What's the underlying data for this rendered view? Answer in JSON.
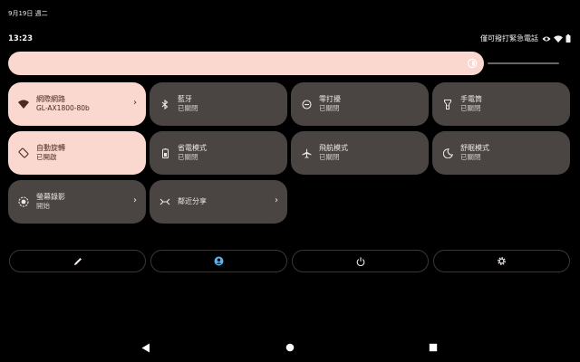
{
  "status_bar": {
    "date": "9月19日 週二",
    "time": "13:23",
    "network_status": "僅可撥打緊急電話",
    "icons": [
      "eye-icon",
      "wifi-icon",
      "battery-icon"
    ]
  },
  "brightness": {
    "level": 0.93,
    "icon": "brightness-icon",
    "color": "#fad7cf"
  },
  "tiles": [
    {
      "id": "internet",
      "label": "網際網路",
      "sub": "GL-AX1800-80b",
      "icon": "wifi-icon",
      "active": true,
      "chevron": true
    },
    {
      "id": "bluetooth",
      "label": "藍牙",
      "sub": "已關閉",
      "icon": "bluetooth-icon",
      "active": false,
      "chevron": false
    },
    {
      "id": "dnd",
      "label": "零打擾",
      "sub": "已關閉",
      "icon": "do-not-disturb-icon",
      "active": false,
      "chevron": false
    },
    {
      "id": "flashlight",
      "label": "手電筒",
      "sub": "已關閉",
      "icon": "flashlight-icon",
      "active": false,
      "chevron": false
    },
    {
      "id": "autorotate",
      "label": "自動旋轉",
      "sub": "已開啟",
      "icon": "rotate-icon",
      "active": true,
      "chevron": false
    },
    {
      "id": "battery-saver",
      "label": "省電模式",
      "sub": "已關閉",
      "icon": "battery-saver-icon",
      "active": false,
      "chevron": false
    },
    {
      "id": "airplane",
      "label": "飛航模式",
      "sub": "已關閉",
      "icon": "airplane-icon",
      "active": false,
      "chevron": false
    },
    {
      "id": "bedtime",
      "label": "舒眠模式",
      "sub": "已關閉",
      "icon": "moon-icon",
      "active": false,
      "chevron": false
    },
    {
      "id": "screen-record",
      "label": "螢幕錄影",
      "sub": "開始",
      "icon": "screen-record-icon",
      "active": false,
      "chevron": true
    },
    {
      "id": "nearby-share",
      "label": "鄰近分享",
      "sub": "",
      "icon": "nearby-share-icon",
      "active": false,
      "chevron": true
    }
  ],
  "bottom_buttons": [
    {
      "id": "edit",
      "icon": "pencil-icon"
    },
    {
      "id": "user",
      "icon": "user-icon"
    },
    {
      "id": "power",
      "icon": "power-icon"
    },
    {
      "id": "settings",
      "icon": "gear-icon"
    }
  ],
  "nav": [
    {
      "id": "back",
      "icon": "back-triangle-icon"
    },
    {
      "id": "home",
      "icon": "home-circle-icon"
    },
    {
      "id": "recents",
      "icon": "recents-square-icon"
    }
  ],
  "colors": {
    "background": "#000000",
    "tile_inactive": "#4a4543",
    "tile_active": "#fad7cf",
    "accent_user": "#57b4f2"
  }
}
